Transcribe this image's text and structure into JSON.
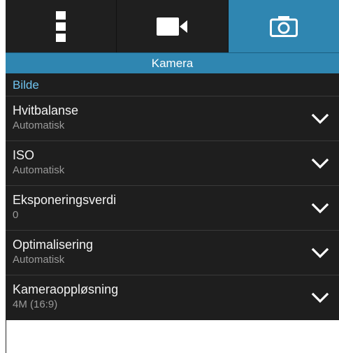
{
  "tabs": [
    {
      "icon": "vertical-dots-icon",
      "active": false
    },
    {
      "icon": "video-camera-icon",
      "active": false
    },
    {
      "icon": "camera-icon",
      "active": true
    }
  ],
  "header": {
    "title": "Kamera"
  },
  "section": {
    "title": "Bilde"
  },
  "settings": [
    {
      "title": "Hvitbalanse",
      "value": "Automatisk"
    },
    {
      "title": "ISO",
      "value": "Automatisk"
    },
    {
      "title": "Eksponeringsverdi",
      "value": "0"
    },
    {
      "title": "Optimalisering",
      "value": "Automatisk"
    },
    {
      "title": "Kameraoppløsning",
      "value": "4M (16:9)"
    }
  ],
  "colors": {
    "accent": "#2f86b1",
    "section_title": "#6fc3ef",
    "background": "#1e1e1e"
  }
}
